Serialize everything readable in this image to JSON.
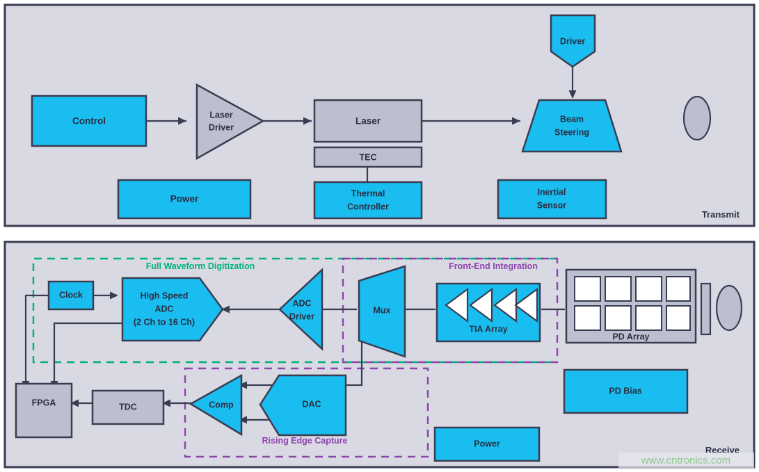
{
  "diagram": {
    "colors": {
      "cyan": "#19bdf0",
      "gray_fill": "#bcc0ce",
      "panel_bg": "#d9d9e3",
      "stroke": "#3a3d52",
      "green": "#00b277",
      "purple": "#8e44ad",
      "watermark": "#8fc98f"
    }
  },
  "transmit": {
    "panel_label": "Transmit",
    "blocks": {
      "control": "Control",
      "laser_driver_line1": "Laser",
      "laser_driver_line2": "Driver",
      "laser": "Laser",
      "tec": "TEC",
      "thermal_line1": "Thermal",
      "thermal_line2": "Controller",
      "power": "Power",
      "inertial_line1": "Inertial",
      "inertial_line2": "Sensor",
      "driver": "Driver",
      "beam_line1": "Beam",
      "beam_line2": "Steering",
      "lens": "lens-ellipse"
    }
  },
  "receive": {
    "panel_label": "Receive",
    "group_labels": {
      "full_waveform": "Full Waveform Digitization",
      "front_end": "Front-End Integration",
      "rising_edge": "Rising Edge Capture"
    },
    "blocks": {
      "clock": "Clock",
      "adc_line1": "High Speed",
      "adc_line2": "ADC",
      "adc_line3": "(2 Ch to 16 Ch)",
      "adc_driver_line1": "ADC",
      "adc_driver_line2": "Driver",
      "mux": "Mux",
      "tia_array": "TIA Array",
      "pd_array": "PD Array",
      "pd_bias": "PD Bias",
      "power": "Power",
      "fpga": "FPGA",
      "tdc": "TDC",
      "comp": "Comp",
      "dac": "DAC",
      "lens": "lens-ellipse",
      "aperture": "aperture-bar"
    }
  },
  "watermark": {
    "text": "www.cntronics.com"
  }
}
